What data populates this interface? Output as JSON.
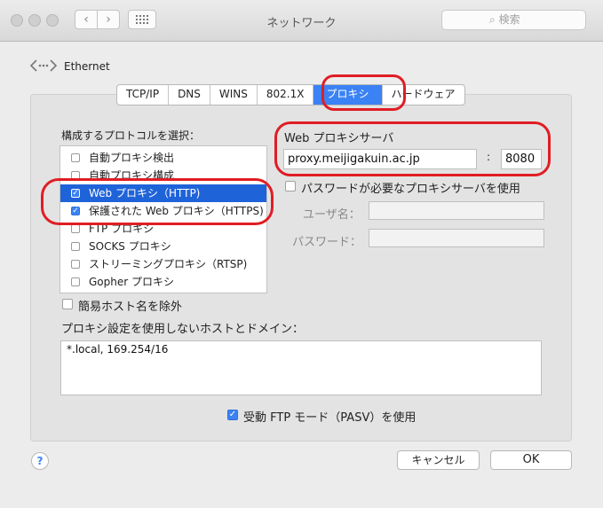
{
  "window": {
    "title": "ネットワーク",
    "search_placeholder": "検索"
  },
  "service": {
    "name": "Ethernet"
  },
  "tabs": [
    {
      "label": "TCP/IP"
    },
    {
      "label": "DNS"
    },
    {
      "label": "WINS"
    },
    {
      "label": "802.1X"
    },
    {
      "label": "プロキシ",
      "selected": true
    },
    {
      "label": "ハードウェア"
    }
  ],
  "protocols": {
    "heading": "構成するプロトコルを選択：",
    "items": [
      {
        "label": "自動プロキシ検出",
        "checked": false
      },
      {
        "label": "自動プロキシ構成",
        "checked": false
      },
      {
        "label": "Web プロキシ（HTTP)",
        "checked": true,
        "selected": true
      },
      {
        "label": "保護された Web プロキシ（HTTPS)",
        "checked": true
      },
      {
        "label": "FTP プロキシ",
        "checked": false
      },
      {
        "label": "SOCKS プロキシ",
        "checked": false
      },
      {
        "label": "ストリーミングプロキシ（RTSP)",
        "checked": false
      },
      {
        "label": "Gopher プロキシ",
        "checked": false
      }
    ]
  },
  "server": {
    "heading": "Web プロキシサーバ",
    "host": "proxy.meijigakuin.ac.jp",
    "separator": ":",
    "port": "8080",
    "password_required_label": "パスワードが必要なプロキシサーバを使用",
    "username_label": "ユーザ名：",
    "password_label": "パスワード："
  },
  "simple_hostnames": {
    "label": "簡易ホスト名を除外",
    "checked": false
  },
  "bypass": {
    "label": "プロキシ設定を使用しないホストとドメイン：",
    "value": "*.local, 169.254/16"
  },
  "passive_ftp": {
    "label": "受動 FTP モード（PASV）を使用",
    "checked": true
  },
  "buttons": {
    "help": "?",
    "cancel": "キャンセル",
    "ok": "OK"
  },
  "colors": {
    "accent": "#3b82f5",
    "selection": "#1f63d9",
    "annotation": "#e01d24"
  }
}
